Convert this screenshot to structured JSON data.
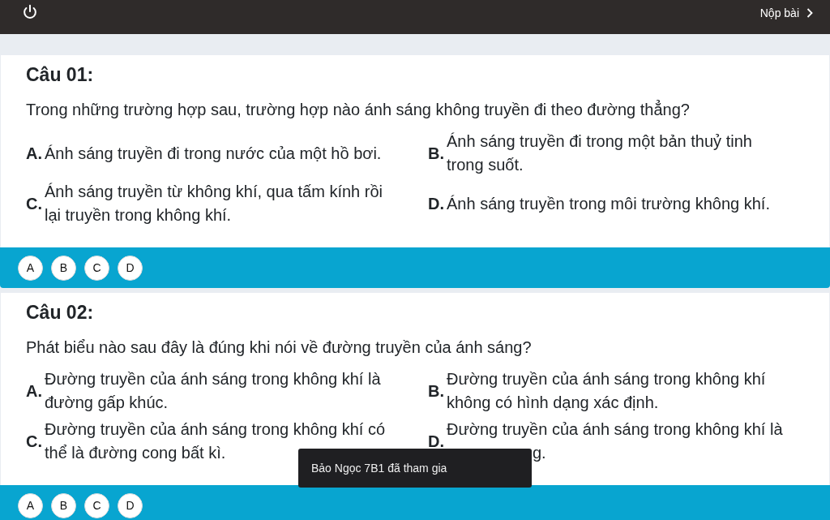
{
  "top_bar": {
    "submit": "Nộp bài"
  },
  "questions": [
    {
      "title": "Câu 01:",
      "text": "Trong những trường hợp sau, trường hợp nào ánh sáng không truyền đi theo đường thẳng?",
      "options": [
        {
          "letter": "A.",
          "text": "Ánh sáng truyền đi trong nước của một hồ bơi."
        },
        {
          "letter": "B.",
          "text": "Ánh sáng truyền đi trong một bản thuỷ tinh trong suốt."
        },
        {
          "letter": "C.",
          "text": "Ánh sáng truyền từ không khí, qua tấm kính rồi lại truyền trong không khí."
        },
        {
          "letter": "D.",
          "text": "Ánh sáng truyền trong môi trường không khí."
        }
      ],
      "answers": [
        "A",
        "B",
        "C",
        "D"
      ]
    },
    {
      "title": "Câu 02:",
      "text": "Phát biểu nào sau đây là đúng khi nói về đường truyền của ánh sáng?",
      "options": [
        {
          "letter": "A.",
          "text": "Đường truyền của ánh sáng trong không khí là đường gấp khúc."
        },
        {
          "letter": "B.",
          "text": "Đường truyền của ánh sáng trong không khí không có hình dạng xác định."
        },
        {
          "letter": "C.",
          "text": "Đường truyền của ánh sáng trong không khí có thể là đường cong bất kì."
        },
        {
          "letter": "D.",
          "text": "Đường truyền của ánh sáng trong không khí là",
          "covered_tail": "g."
        }
      ],
      "answers": [
        "A",
        "B",
        "C",
        "D"
      ]
    }
  ],
  "toast": "Bảo Ngọc 7B1 đã tham gia"
}
